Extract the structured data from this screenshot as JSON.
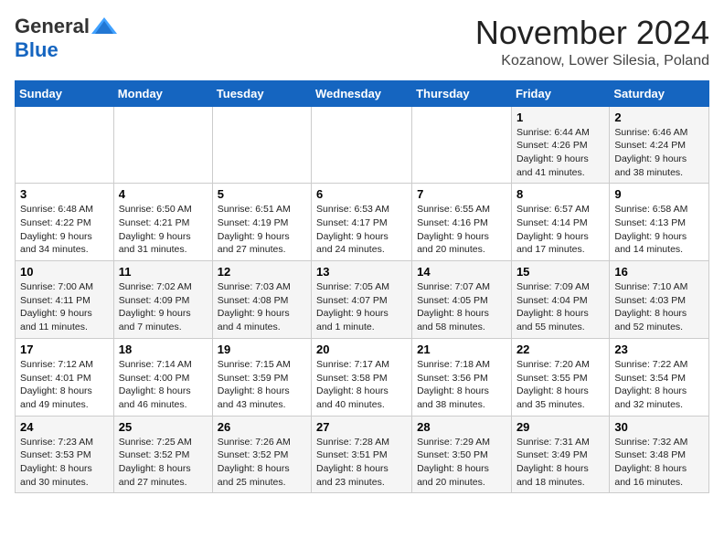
{
  "header": {
    "logo": {
      "general": "General",
      "blue": "Blue"
    },
    "title": "November 2024",
    "location": "Kozanow, Lower Silesia, Poland"
  },
  "days_of_week": [
    "Sunday",
    "Monday",
    "Tuesday",
    "Wednesday",
    "Thursday",
    "Friday",
    "Saturday"
  ],
  "weeks": [
    [
      {
        "day": "",
        "info": ""
      },
      {
        "day": "",
        "info": ""
      },
      {
        "day": "",
        "info": ""
      },
      {
        "day": "",
        "info": ""
      },
      {
        "day": "",
        "info": ""
      },
      {
        "day": "1",
        "info": "Sunrise: 6:44 AM\nSunset: 4:26 PM\nDaylight: 9 hours\nand 41 minutes."
      },
      {
        "day": "2",
        "info": "Sunrise: 6:46 AM\nSunset: 4:24 PM\nDaylight: 9 hours\nand 38 minutes."
      }
    ],
    [
      {
        "day": "3",
        "info": "Sunrise: 6:48 AM\nSunset: 4:22 PM\nDaylight: 9 hours\nand 34 minutes."
      },
      {
        "day": "4",
        "info": "Sunrise: 6:50 AM\nSunset: 4:21 PM\nDaylight: 9 hours\nand 31 minutes."
      },
      {
        "day": "5",
        "info": "Sunrise: 6:51 AM\nSunset: 4:19 PM\nDaylight: 9 hours\nand 27 minutes."
      },
      {
        "day": "6",
        "info": "Sunrise: 6:53 AM\nSunset: 4:17 PM\nDaylight: 9 hours\nand 24 minutes."
      },
      {
        "day": "7",
        "info": "Sunrise: 6:55 AM\nSunset: 4:16 PM\nDaylight: 9 hours\nand 20 minutes."
      },
      {
        "day": "8",
        "info": "Sunrise: 6:57 AM\nSunset: 4:14 PM\nDaylight: 9 hours\nand 17 minutes."
      },
      {
        "day": "9",
        "info": "Sunrise: 6:58 AM\nSunset: 4:13 PM\nDaylight: 9 hours\nand 14 minutes."
      }
    ],
    [
      {
        "day": "10",
        "info": "Sunrise: 7:00 AM\nSunset: 4:11 PM\nDaylight: 9 hours\nand 11 minutes."
      },
      {
        "day": "11",
        "info": "Sunrise: 7:02 AM\nSunset: 4:09 PM\nDaylight: 9 hours\nand 7 minutes."
      },
      {
        "day": "12",
        "info": "Sunrise: 7:03 AM\nSunset: 4:08 PM\nDaylight: 9 hours\nand 4 minutes."
      },
      {
        "day": "13",
        "info": "Sunrise: 7:05 AM\nSunset: 4:07 PM\nDaylight: 9 hours\nand 1 minute."
      },
      {
        "day": "14",
        "info": "Sunrise: 7:07 AM\nSunset: 4:05 PM\nDaylight: 8 hours\nand 58 minutes."
      },
      {
        "day": "15",
        "info": "Sunrise: 7:09 AM\nSunset: 4:04 PM\nDaylight: 8 hours\nand 55 minutes."
      },
      {
        "day": "16",
        "info": "Sunrise: 7:10 AM\nSunset: 4:03 PM\nDaylight: 8 hours\nand 52 minutes."
      }
    ],
    [
      {
        "day": "17",
        "info": "Sunrise: 7:12 AM\nSunset: 4:01 PM\nDaylight: 8 hours\nand 49 minutes."
      },
      {
        "day": "18",
        "info": "Sunrise: 7:14 AM\nSunset: 4:00 PM\nDaylight: 8 hours\nand 46 minutes."
      },
      {
        "day": "19",
        "info": "Sunrise: 7:15 AM\nSunset: 3:59 PM\nDaylight: 8 hours\nand 43 minutes."
      },
      {
        "day": "20",
        "info": "Sunrise: 7:17 AM\nSunset: 3:58 PM\nDaylight: 8 hours\nand 40 minutes."
      },
      {
        "day": "21",
        "info": "Sunrise: 7:18 AM\nSunset: 3:56 PM\nDaylight: 8 hours\nand 38 minutes."
      },
      {
        "day": "22",
        "info": "Sunrise: 7:20 AM\nSunset: 3:55 PM\nDaylight: 8 hours\nand 35 minutes."
      },
      {
        "day": "23",
        "info": "Sunrise: 7:22 AM\nSunset: 3:54 PM\nDaylight: 8 hours\nand 32 minutes."
      }
    ],
    [
      {
        "day": "24",
        "info": "Sunrise: 7:23 AM\nSunset: 3:53 PM\nDaylight: 8 hours\nand 30 minutes."
      },
      {
        "day": "25",
        "info": "Sunrise: 7:25 AM\nSunset: 3:52 PM\nDaylight: 8 hours\nand 27 minutes."
      },
      {
        "day": "26",
        "info": "Sunrise: 7:26 AM\nSunset: 3:52 PM\nDaylight: 8 hours\nand 25 minutes."
      },
      {
        "day": "27",
        "info": "Sunrise: 7:28 AM\nSunset: 3:51 PM\nDaylight: 8 hours\nand 23 minutes."
      },
      {
        "day": "28",
        "info": "Sunrise: 7:29 AM\nSunset: 3:50 PM\nDaylight: 8 hours\nand 20 minutes."
      },
      {
        "day": "29",
        "info": "Sunrise: 7:31 AM\nSunset: 3:49 PM\nDaylight: 8 hours\nand 18 minutes."
      },
      {
        "day": "30",
        "info": "Sunrise: 7:32 AM\nSunset: 3:48 PM\nDaylight: 8 hours\nand 16 minutes."
      }
    ]
  ]
}
